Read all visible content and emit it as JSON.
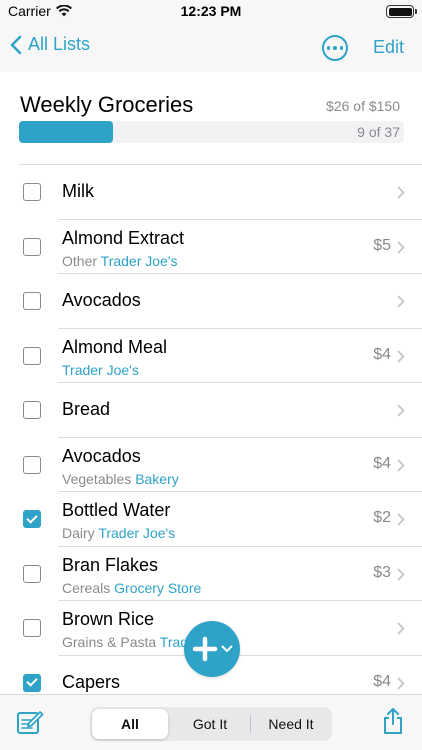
{
  "status_bar": {
    "carrier": "Carrier",
    "time": "12:23 PM"
  },
  "nav": {
    "back_label": "All Lists",
    "edit_label": "Edit"
  },
  "list": {
    "title": "Weekly Groceries",
    "budget": "$26 of $150",
    "count": "9 of 37",
    "progress_fraction": 0.243
  },
  "items": [
    {
      "name": "Milk",
      "category": "",
      "store": "",
      "price": "",
      "checked": false
    },
    {
      "name": "Almond Extract",
      "category": "Other",
      "store": "Trader Joe's",
      "price": "$5",
      "checked": false
    },
    {
      "name": "Avocados",
      "category": "",
      "store": "",
      "price": "",
      "checked": false
    },
    {
      "name": "Almond Meal",
      "category": "",
      "store": "Trader Joe's",
      "price": "$4",
      "checked": false
    },
    {
      "name": "Bread",
      "category": "",
      "store": "",
      "price": "",
      "checked": false
    },
    {
      "name": "Avocados",
      "category": "Vegetables",
      "store": "Bakery",
      "price": "$4",
      "checked": false
    },
    {
      "name": "Bottled Water",
      "category": "Dairy",
      "store": "Trader Joe's",
      "price": "$2",
      "checked": true
    },
    {
      "name": "Bran Flakes",
      "category": "Cereals",
      "store": "Grocery Store",
      "price": "$3",
      "checked": false
    },
    {
      "name": "Brown Rice",
      "category": "Grains & Pasta",
      "store": "Trader Joe's",
      "price": "",
      "checked": false
    },
    {
      "name": "Capers",
      "category": "",
      "store": "",
      "price": "$4",
      "checked": true
    }
  ],
  "filter": {
    "all": "All",
    "got_it": "Got It",
    "need_it": "Need It",
    "selected": "All"
  },
  "colors": {
    "accent": "#2ea3c7",
    "secondary_text": "#8a8a8e"
  },
  "icons": {
    "back": "chevron-left-icon",
    "more": "ellipsis-circle-icon",
    "row_disclosure": "chevron-right-icon",
    "add": "plus-icon",
    "add_menu": "chevron-down-icon",
    "notes": "compose-note-icon",
    "share": "share-icon"
  }
}
